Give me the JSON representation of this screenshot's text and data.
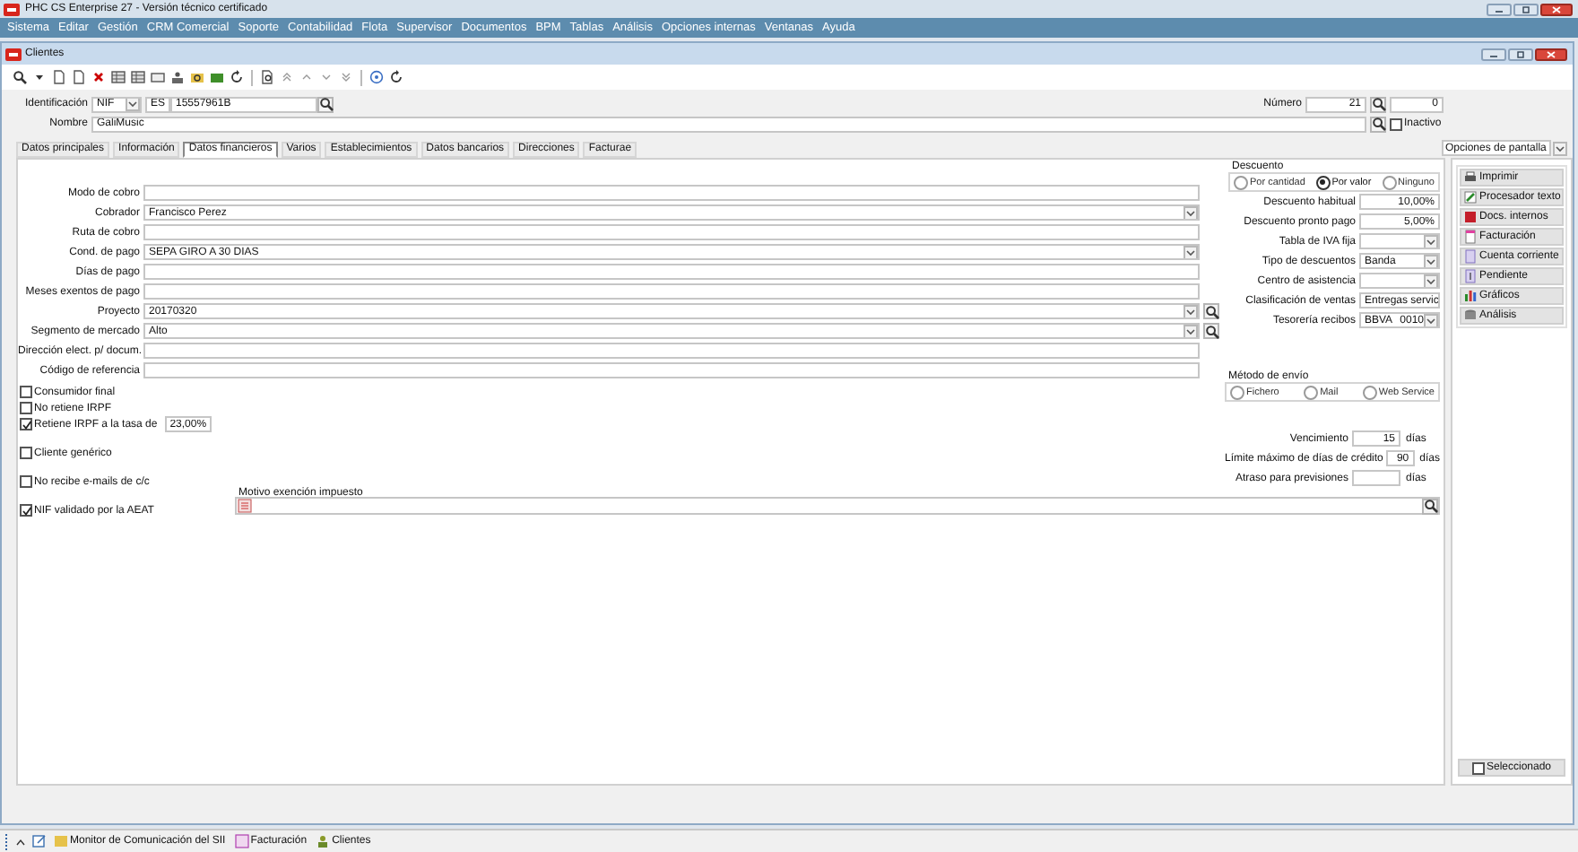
{
  "app": {
    "title": "PHC CS Enterprise 27 - Versión técnico certificado"
  },
  "menu": [
    "Sistema",
    "Editar",
    "Gestión",
    "CRM Comercial",
    "Soporte",
    "Contabilidad",
    "Flota",
    "Supervisor",
    "Documentos",
    "BPM",
    "Tablas",
    "Análisis",
    "Opciones internas",
    "Ventanas",
    "Ayuda"
  ],
  "window": {
    "title": "Clientes"
  },
  "header": {
    "identification_label": "Identificación",
    "id_type": "NIF",
    "country": "ES",
    "tax_id": "15557961B",
    "name_label": "Nombre",
    "name": "GaliMusic",
    "number_label": "Número",
    "number": "21",
    "number_2": "0",
    "inactive": {
      "label": "Inactivo",
      "checked": false
    }
  },
  "tabs": [
    {
      "label": "Datos principales",
      "selected": false
    },
    {
      "label": "Información",
      "selected": false
    },
    {
      "label": "Datos financieros",
      "selected": true
    },
    {
      "label": "Varios",
      "selected": false
    },
    {
      "label": "Establecimientos",
      "selected": false
    },
    {
      "label": "Datos bancarios",
      "selected": false
    },
    {
      "label": "Direcciones",
      "selected": false
    },
    {
      "label": "Facturae",
      "selected": false
    }
  ],
  "screen_options": {
    "label": "Opciones de pantalla"
  },
  "fields": [
    {
      "label": "Modo de cobro",
      "kind": "text"
    },
    {
      "label": "Cobrador",
      "value": "Francisco Perez",
      "kind": "select"
    },
    {
      "label": "Ruta de cobro",
      "kind": "text"
    },
    {
      "label": "Cond. de pago",
      "value": "SEPA GIRO A 30 DIAS",
      "kind": "select"
    },
    {
      "label": "Días de pago",
      "kind": "text"
    },
    {
      "label": "Meses exentos de pago",
      "kind": "text"
    },
    {
      "label": "Proyecto",
      "value": "20170320",
      "kind": "select_search"
    },
    {
      "label": "Segmento de mercado",
      "value": "Alto",
      "kind": "select_search"
    },
    {
      "label": "Dirección elect. p/ docum.",
      "kind": "text"
    },
    {
      "label": "Código de referencia",
      "kind": "text"
    }
  ],
  "discount": {
    "title": "Descuento",
    "options": [
      {
        "label": "Por cantidad",
        "selected": false
      },
      {
        "label": "Por valor",
        "selected": true
      },
      {
        "label": "Ninguno",
        "selected": false
      }
    ]
  },
  "discount_fields": [
    {
      "label": "Descuento habitual",
      "value": "10,00%",
      "kind": "number"
    },
    {
      "label": "Descuento pronto pago",
      "value": "5,00%",
      "kind": "number"
    },
    {
      "label": "Tabla de IVA fija",
      "kind": "select"
    },
    {
      "label": "Tipo de descuentos",
      "value": "Banda",
      "kind": "select"
    },
    {
      "label": "Centro de asistencia",
      "kind": "select"
    },
    {
      "label": "Clasificación de ventas",
      "value": "Entregas servic",
      "kind": "select"
    },
    {
      "label": "Tesorería recibos",
      "value": "BBVA",
      "code": "0010",
      "kind": "select"
    }
  ],
  "options": [
    {
      "label": "Consumidor final",
      "checked": false
    },
    {
      "label": "No retiene IRPF",
      "checked": false
    },
    {
      "label": "Retiene IRPF a la tasa de",
      "checked": true,
      "rate": "23,00%"
    },
    {
      "label": "Cliente genérico",
      "checked": false
    },
    {
      "label": "No recibe e-mails de c/c",
      "checked": false
    },
    {
      "label": "NIF validado por la AEAT",
      "checked": true
    }
  ],
  "shipping": {
    "title": "Método de envío",
    "options": [
      {
        "label": "Fichero",
        "selected": false
      },
      {
        "label": "Mail",
        "selected": false
      },
      {
        "label": "Web Service",
        "selected": false
      }
    ]
  },
  "terms": [
    {
      "label": "Vencimiento",
      "value": "15",
      "unit": "días"
    },
    {
      "label": "Límite máximo de días de crédito",
      "value": "90",
      "unit": "días"
    },
    {
      "label": "Atraso para previsiones",
      "unit": "días"
    }
  ],
  "exemption": {
    "label": "Motivo exención impuesto"
  },
  "actions": [
    {
      "label": "Imprimir"
    },
    {
      "label": "Procesador texto"
    },
    {
      "label": "Docs. internos"
    },
    {
      "label": "Facturación"
    },
    {
      "label": "Cuenta corriente"
    },
    {
      "label": "Pendiente"
    },
    {
      "label": "Gráficos"
    },
    {
      "label": "Análisis"
    }
  ],
  "selected_filter": {
    "label": "Seleccionado",
    "checked": false
  },
  "taskbar": [
    {
      "label": "Monitor de Comunicación del SII"
    },
    {
      "label": "Facturación"
    },
    {
      "label": "Clientes"
    }
  ]
}
